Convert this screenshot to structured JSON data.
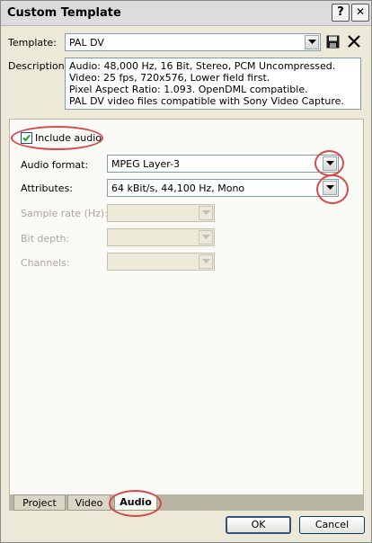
{
  "window": {
    "title": "Custom Template",
    "help_glyph": "?",
    "close_glyph": "✕"
  },
  "template": {
    "label": "Template:",
    "value": "PAL DV"
  },
  "description": {
    "label": "Description:",
    "lines": [
      "Audio: 48,000 Hz, 16 Bit, Stereo, PCM Uncompressed.",
      "Video: 25 fps, 720x576, Lower field first.",
      "Pixel Aspect Ratio: 1.093. OpenDML compatible.",
      "PAL DV video files compatible with Sony Video Capture."
    ]
  },
  "audio_panel": {
    "include_audio": {
      "label": "Include audio",
      "checked": true
    },
    "audio_format": {
      "label": "Audio format:",
      "value": "MPEG Layer-3"
    },
    "attributes": {
      "label": "Attributes:",
      "value": "64 kBit/s, 44,100 Hz, Mono"
    },
    "sample_rate": {
      "label": "Sample rate (Hz):",
      "value": ""
    },
    "bit_depth": {
      "label": "Bit depth:",
      "value": ""
    },
    "channels": {
      "label": "Channels:",
      "value": ""
    }
  },
  "tabs": [
    {
      "label": "Project",
      "active": false
    },
    {
      "label": "Video",
      "active": false
    },
    {
      "label": "Audio",
      "active": true
    }
  ],
  "buttons": {
    "ok": "OK",
    "cancel": "Cancel"
  },
  "icons": {
    "save": "save-disk-icon",
    "delete": "delete-x-icon",
    "dropdown": "chevron-down-icon"
  },
  "colors": {
    "annotation_circle": "#d84a4a",
    "title_bar": "#dcdcdc",
    "dialog_bg": "#ece9d8"
  }
}
